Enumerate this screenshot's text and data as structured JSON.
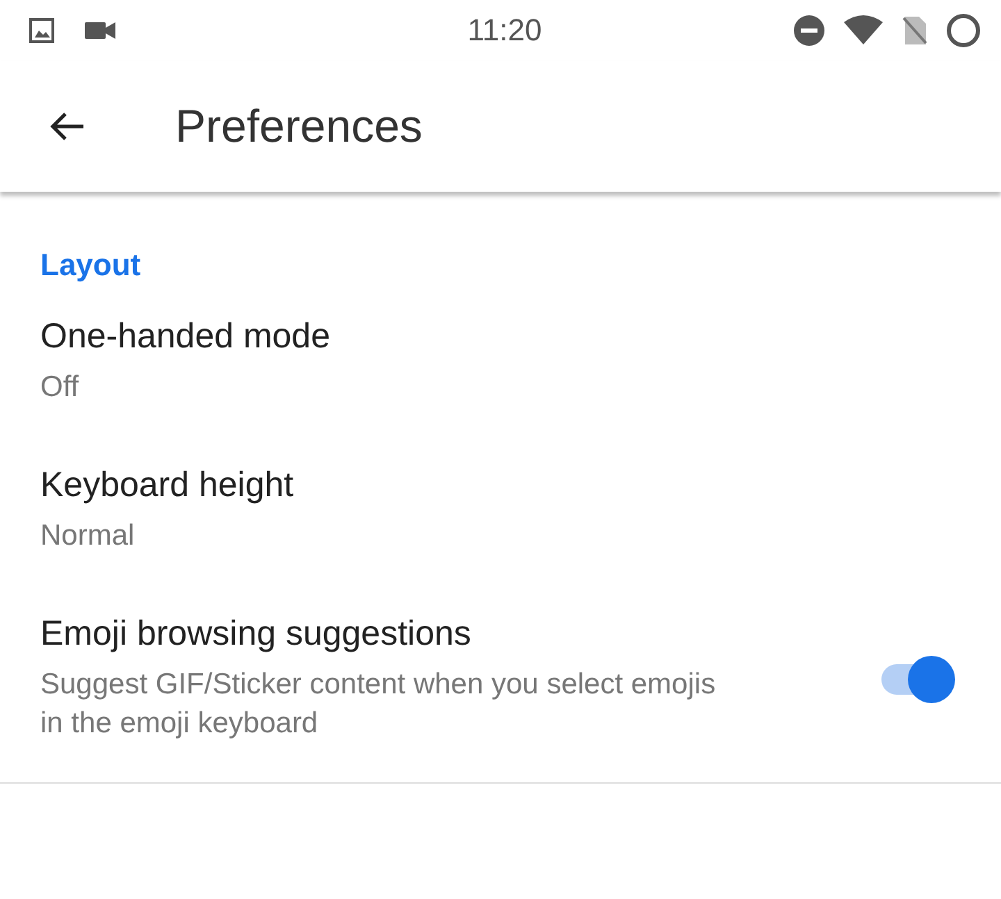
{
  "status_bar": {
    "time": "11:20"
  },
  "app_bar": {
    "title": "Preferences"
  },
  "section": {
    "title": "Layout"
  },
  "settings": [
    {
      "kind": "plain",
      "title": "One-handed mode",
      "summary": "Off"
    },
    {
      "kind": "plain",
      "title": "Keyboard height",
      "summary": "Normal"
    },
    {
      "kind": "switch",
      "title": "Emoji browsing suggestions",
      "summary": "Suggest GIF/Sticker content when you select emojis in the emoji keyboard",
      "on": true
    }
  ]
}
